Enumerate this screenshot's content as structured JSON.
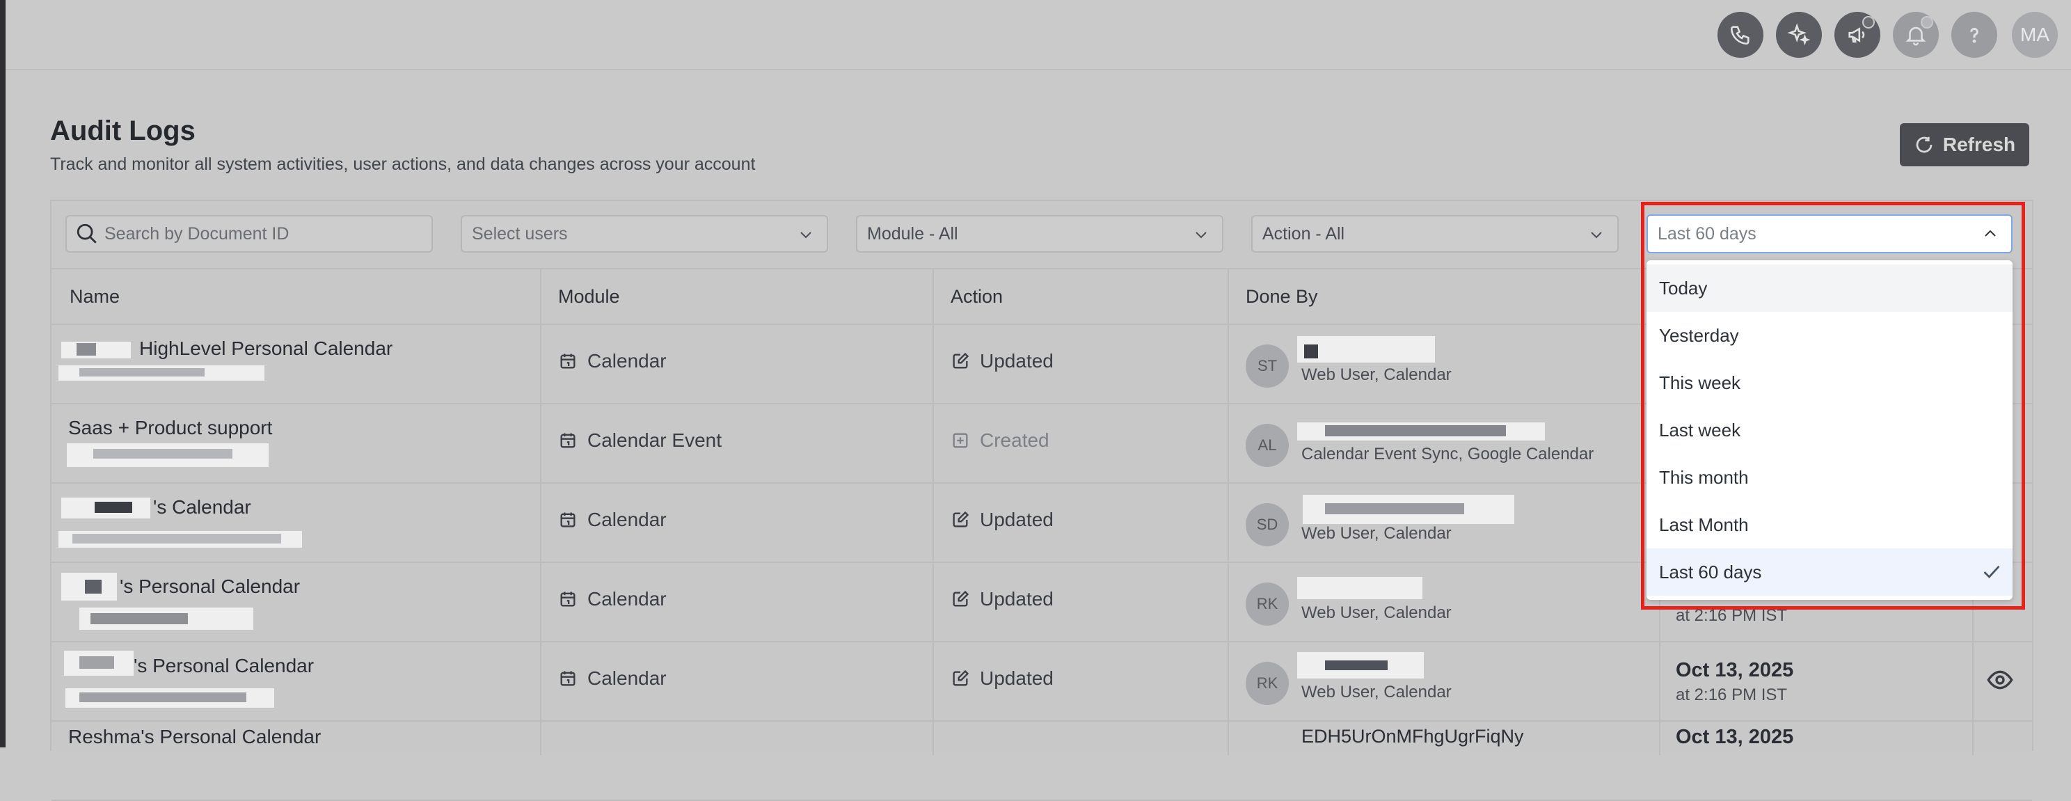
{
  "topbar": {
    "icons": [
      "phone-icon",
      "sparkle-icon",
      "megaphone-icon",
      "bell-icon",
      "help-icon"
    ],
    "avatar_initials": "MA"
  },
  "header": {
    "title": "Audit Logs",
    "subtitle": "Track and monitor all system activities, user actions, and data changes across your account",
    "refresh_label": "Refresh"
  },
  "filters": {
    "search_placeholder": "Search by Document ID",
    "users_placeholder": "Select users",
    "module_value": "Module - All",
    "action_value": "Action - All",
    "date_value": "Last 60 days"
  },
  "columns": {
    "name": "Name",
    "module": "Module",
    "action": "Action",
    "done_by": "Done By"
  },
  "rows": [
    {
      "name": "HighLevel Personal Calendar",
      "module": "Calendar",
      "action": "Updated",
      "initials": "ST",
      "source": "Web User, Calendar"
    },
    {
      "name": "Saas + Product support",
      "module": "Calendar Event",
      "action": "Created",
      "initials": "AL",
      "source": "Calendar Event Sync, Google Calendar"
    },
    {
      "name": "'s Calendar",
      "module": "Calendar",
      "action": "Updated",
      "initials": "SD",
      "source": "Web User, Calendar"
    },
    {
      "name": "'s Personal Calendar",
      "module": "Calendar",
      "action": "Updated",
      "initials": "RK",
      "source": "Web User, Calendar",
      "time": "at 2:16 PM IST"
    },
    {
      "name": "'s Personal Calendar",
      "module": "Calendar",
      "action": "Updated",
      "initials": "RK",
      "source": "Web User, Calendar",
      "date": "Oct 13, 2025",
      "time": "at 2:16 PM IST"
    },
    {
      "name": "Reshma's Personal Calendar",
      "done_by_partial": "EDH5UrOnMFhgUgrFiqNy",
      "date": "Oct 13, 2025"
    }
  ],
  "date_dropdown": {
    "options": [
      "Today",
      "Yesterday",
      "This week",
      "Last week",
      "This month",
      "Last Month",
      "Last 60 days"
    ],
    "selected": "Last 60 days",
    "hovered": "Today"
  },
  "colors": {
    "highlight_outline": "#e4231c",
    "dropdown_focus_border": "#7fa6e8",
    "selected_option_bg": "#eef3fd",
    "checkmark": "#4a5568"
  }
}
